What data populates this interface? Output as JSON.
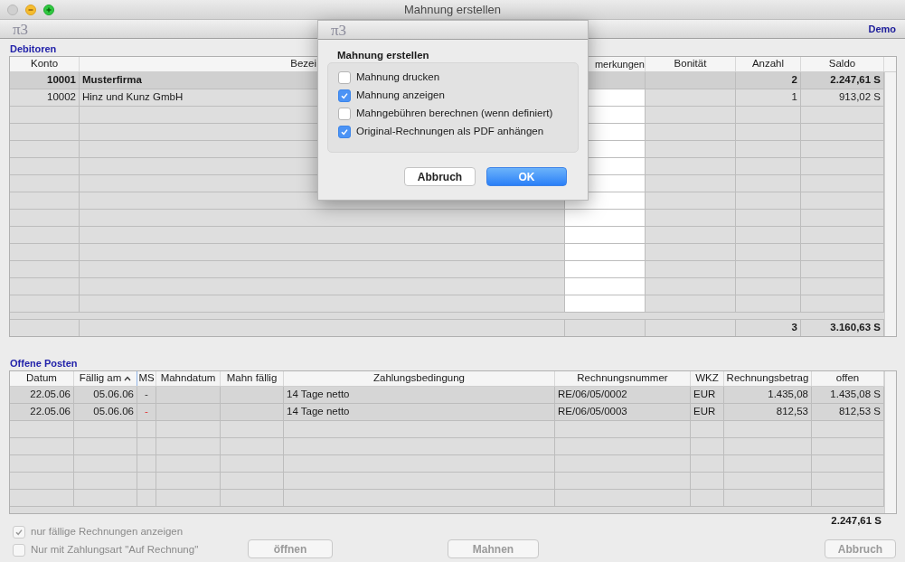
{
  "window": {
    "title": "Mahnung erstellen",
    "logo": "π3",
    "badge": "Demo"
  },
  "debitoren": {
    "label": "Debitoren",
    "columns": [
      {
        "label": "Konto"
      },
      {
        "label": "Bezei"
      },
      {
        "label": "merkungen"
      },
      {
        "label": "Bonität"
      },
      {
        "label": "Anzahl"
      },
      {
        "label": "Saldo"
      }
    ],
    "rows": [
      {
        "konto": "10001",
        "bezeichnung": "Musterfirma",
        "anzahl": "2",
        "saldo": "2.247,61 S",
        "selected": true
      },
      {
        "konto": "10002",
        "bezeichnung": "Hinz und Kunz GmbH",
        "anzahl": "1",
        "saldo": "913,02 S",
        "selected": false
      }
    ],
    "totals": {
      "anzahl": "3",
      "saldo": "3.160,63 S"
    }
  },
  "offene_posten": {
    "label": "Offene Posten",
    "columns": [
      {
        "label": "Datum",
        "sorted": false
      },
      {
        "label": "Fällig am",
        "sorted": true
      },
      {
        "label": "MS",
        "sorted": false
      },
      {
        "label": "Mahndatum",
        "sorted": false
      },
      {
        "label": "Mahn fällig",
        "sorted": false
      },
      {
        "label": "Zahlungsbedingung",
        "sorted": false
      },
      {
        "label": "Rechnungsnummer",
        "sorted": false
      },
      {
        "label": "WKZ",
        "sorted": false
      },
      {
        "label": "Rechnungsbetrag",
        "sorted": false
      },
      {
        "label": "offen",
        "sorted": false
      }
    ],
    "rows": [
      {
        "datum": "22.05.06",
        "faellig": "05.06.06",
        "ms": "-",
        "overdue": false,
        "zahlungsbedingung": "14 Tage netto",
        "rechnungsnummer": "RE/06/05/0002",
        "wkz": "EUR",
        "betrag": "1.435,08",
        "offen": "1.435,08 S"
      },
      {
        "datum": "22.05.06",
        "faellig": "05.06.06",
        "ms": "-",
        "overdue": true,
        "zahlungsbedingung": "14 Tage netto",
        "rechnungsnummer": "RE/06/05/0003",
        "wkz": "EUR",
        "betrag": "812,53",
        "offen": "812,53 S"
      }
    ],
    "total": "2.247,61 S"
  },
  "options": [
    {
      "label": "nur fällige Rechnungen anzeigen",
      "checked": true,
      "disabled": true
    },
    {
      "label": "Nur mit Zahlungsart \"Auf Rechnung\"",
      "checked": false,
      "disabled": true
    }
  ],
  "buttons": [
    {
      "label": "öffnen",
      "disabled": true
    },
    {
      "label": "Mahnen",
      "disabled": true
    },
    {
      "label": "Abbruch",
      "disabled": true
    }
  ],
  "dialog": {
    "logo": "π3",
    "title": "Mahnung erstellen",
    "options": [
      {
        "label": "Mahnung drucken",
        "checked": false
      },
      {
        "label": "Mahnung anzeigen",
        "checked": true
      },
      {
        "label": "Mahngebühren berechnen (wenn definiert)",
        "checked": false
      },
      {
        "label": "Original-Rechnungen als PDF anhängen",
        "checked": true
      }
    ],
    "buttons": [
      {
        "label": "Abbruch",
        "default": false
      },
      {
        "label": "OK",
        "default": true
      }
    ]
  }
}
